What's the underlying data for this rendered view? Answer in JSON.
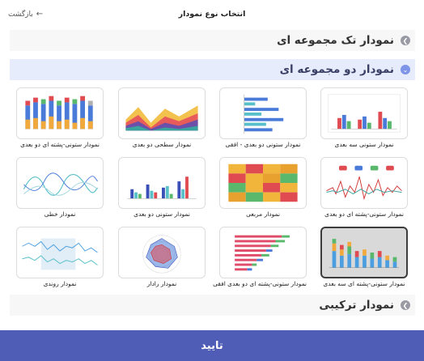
{
  "dialog": {
    "title": "انتخاب نوع نمودار",
    "back_label": "بازگشت",
    "confirm_label": "تایید"
  },
  "sections": {
    "single": "نمودار تک مجموعه ای",
    "double": "نمودار دو مجموعه ای",
    "combo": "نمودار ترکیبی"
  },
  "charts": [
    {
      "caption": "نمودار ستونی سه بعدی"
    },
    {
      "caption": "نمودار ستونی دو بعدی - افقی"
    },
    {
      "caption": "نمودار سطحی دو بعدی"
    },
    {
      "caption": "نمودار ستونی-پشته ای دو بعدی"
    },
    {
      "caption": "نمودار ستونی-پشته ای دو بعدی"
    },
    {
      "caption": "نمودار مربعی"
    },
    {
      "caption": "نمودار ستونی دو بعدی"
    },
    {
      "caption": "نمودار خطی"
    },
    {
      "caption": "نمودار ستونی-پشته ای سه بعدی"
    },
    {
      "caption": "نمودار ستونی-پشته ای دو بعدی افقی"
    },
    {
      "caption": "نمودار رادار"
    },
    {
      "caption": "نمودار روندی"
    }
  ],
  "colors": {
    "accent": "#4f5db7",
    "section_active": "#e6ecfb"
  }
}
